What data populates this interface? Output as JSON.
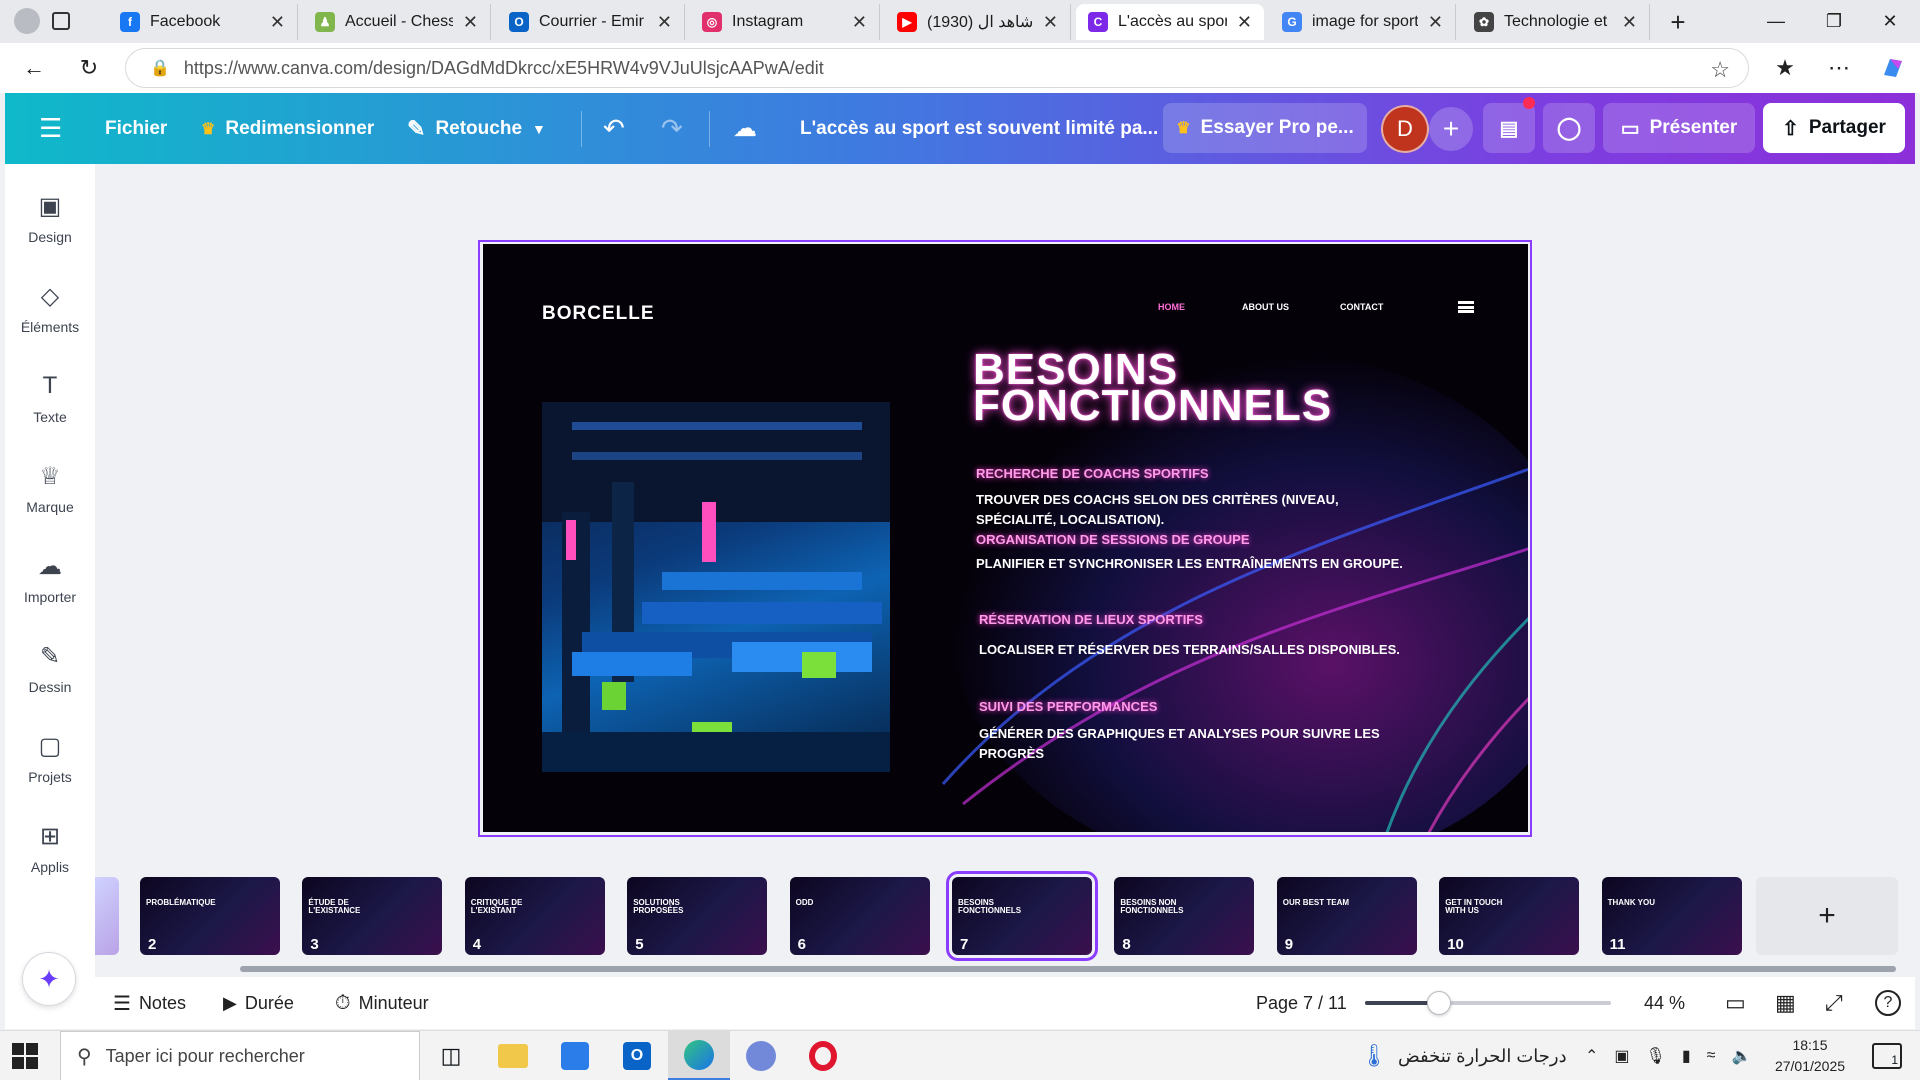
{
  "browser": {
    "tabs": [
      {
        "title": "Facebook",
        "favicon_color": "#1877f2",
        "glyph": "f"
      },
      {
        "title": "Accueil - Chess.co",
        "favicon_color": "#81b64c",
        "glyph": "♟"
      },
      {
        "title": "Courrier - Emir D",
        "favicon_color": "#0a64c8",
        "glyph": "O"
      },
      {
        "title": "Instagram",
        "favicon_color": "#e1306c",
        "glyph": "◎"
      },
      {
        "title": "شاهد ال (1930) 🔴",
        "favicon_color": "#ff0000",
        "glyph": "▶"
      },
      {
        "title": "L'accès au sport e",
        "favicon_color": "#7d2ae8",
        "glyph": "C"
      },
      {
        "title": "image for sport w",
        "favicon_color": "#4285f4",
        "glyph": "G"
      },
      {
        "title": "Technologie et ac",
        "favicon_color": "#444444",
        "glyph": "✿"
      }
    ],
    "new_tab": "+",
    "url": "https://www.canva.com/design/DAGdMdDkrcc/xE5HRW4v9VJuUlsjcAAPwA/edit"
  },
  "canva_header": {
    "menu": "☰",
    "fichier": "Fichier",
    "redimensionner": "Redimensionner",
    "retouche": "Retouche",
    "title": "L'accès au sport est souvent limité pa...",
    "essayer_pro": "Essayer Pro pe...",
    "avatar_letter": "D",
    "presenter": "Présenter",
    "partager": "Partager"
  },
  "sidebar": {
    "items": [
      {
        "label": "Design",
        "icon": "layout-icon"
      },
      {
        "label": "Éléments",
        "icon": "shapes-icon"
      },
      {
        "label": "Texte",
        "icon": "text-icon"
      },
      {
        "label": "Marque",
        "icon": "brand-icon"
      },
      {
        "label": "Importer",
        "icon": "upload-icon"
      },
      {
        "label": "Dessin",
        "icon": "draw-icon"
      },
      {
        "label": "Projets",
        "icon": "folder-icon"
      },
      {
        "label": "Applis",
        "icon": "apps-icon"
      }
    ]
  },
  "slide": {
    "brand": "BORCELLE",
    "nav": [
      "HOME",
      "ABOUT US",
      "CONTACT"
    ],
    "title_line1": "BESOINS",
    "title_line2": "FONCTIONNELS",
    "sections": [
      {
        "heading": "RECHERCHE DE COACHS SPORTIFS",
        "text": "TROUVER DES COACHS SELON DES CRITÈRES (NIVEAU, SPÉCIALITÉ, LOCALISATION)."
      },
      {
        "heading": "ORGANISATION DE SESSIONS DE GROUPE",
        "text": "PLANIFIER ET SYNCHRONISER LES ENTRAÎNEMENTS EN GROUPE."
      },
      {
        "heading": "RÉSERVATION DE LIEUX SPORTIFS",
        "text": "LOCALISER ET RÉSERVER DES TERRAINS/SALLES DISPONIBLES."
      },
      {
        "heading": "SUIVI DES PERFORMANCES",
        "text": " GÉNÉRER DES GRAPHIQUES ET ANALYSES POUR SUIVRE LES PROGRÈS"
      }
    ]
  },
  "thumbnails": [
    {
      "num": "2",
      "title": "PROBLÉMATIQUE"
    },
    {
      "num": "3",
      "title": "ÉTUDE DE L'EXISTANCE"
    },
    {
      "num": "4",
      "title": "CRITIQUE DE L'EXISTANT"
    },
    {
      "num": "5",
      "title": "SOLUTIONS PROPOSÉES"
    },
    {
      "num": "6",
      "title": "ODD"
    },
    {
      "num": "7",
      "title": "BESOINS FONCTIONNELS"
    },
    {
      "num": "8",
      "title": "BESOINS NON FONCTIONNELS"
    },
    {
      "num": "9",
      "title": "OUR BEST TEAM"
    },
    {
      "num": "10",
      "title": "GET IN TOUCH WITH US"
    },
    {
      "num": "11",
      "title": "THANK YOU"
    }
  ],
  "bottom_bar": {
    "notes": "Notes",
    "duree": "Durée",
    "minuteur": "Minuteur",
    "page": "Page 7 / 11",
    "zoom": "44 %",
    "zoom_fraction": 0.3
  },
  "taskbar": {
    "search_placeholder": "Taper ici pour rechercher",
    "weather": "درجات الحرارة تنخفض",
    "time": "18:15",
    "date": "27/01/2025",
    "notification_count": "1"
  }
}
